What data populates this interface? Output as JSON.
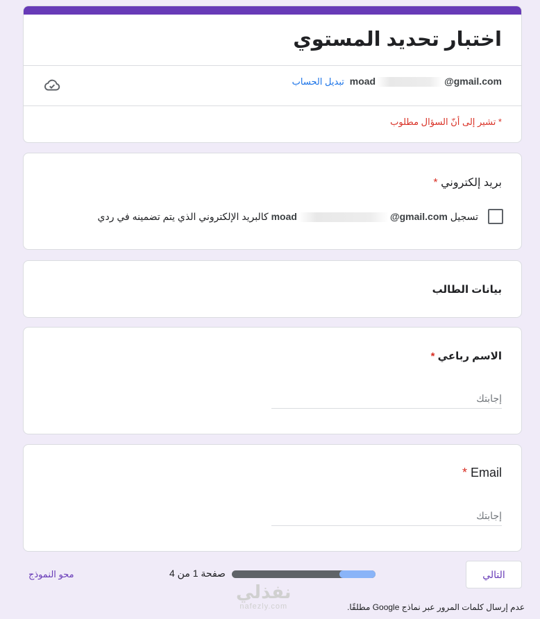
{
  "form": {
    "title": "اختبار تحديد المستوي",
    "account_email_prefix": "moad",
    "account_email_suffix": "@gmail.com",
    "switch_account_label": "تبديل الحساب",
    "cloud_icon": "cloud-check-icon",
    "required_note": "* تشير إلى أنّ السؤال مطلوب"
  },
  "questions": {
    "email_record": {
      "title": "بريد إلكتروني",
      "required_mark": "*",
      "checkbox_prefix": "تسجيل",
      "email_prefix": "moad",
      "email_suffix": "@gmail.com",
      "checkbox_suffix": "كالبريد الإلكتروني الذي يتم تضمينه في ردي",
      "checked": false
    },
    "section": {
      "title": "بيانات الطالب"
    },
    "full_name": {
      "title": "الاسم رباعي",
      "required_mark": "*",
      "placeholder": "إجابتك",
      "value": ""
    },
    "email": {
      "title": "Email",
      "required_mark": "*",
      "placeholder": "إجابتك",
      "value": ""
    }
  },
  "footer": {
    "next_label": "التالي",
    "page_text": "صفحة 1 من 4",
    "progress_fraction": 0.25,
    "clear_label": "محو النموذج",
    "password_note": "عدم إرسال كلمات المرور عبر نماذج Google مطلقًا."
  },
  "watermark": {
    "main": "نفذلي",
    "sub": "nafezly.com"
  },
  "colors": {
    "accent": "#673ab7",
    "required": "#d93025",
    "link": "#1a73e8",
    "background": "#f0ebf8"
  }
}
